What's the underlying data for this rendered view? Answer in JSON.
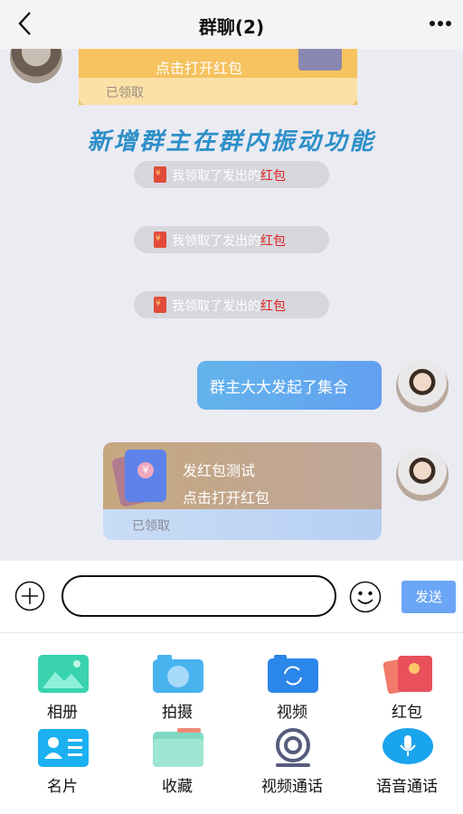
{
  "header": {
    "title": "群聊(2)"
  },
  "chat": {
    "top_packet": {
      "open_text": "点击打开红包",
      "status": "已领取"
    },
    "banner": "新增群主在群内振动功能",
    "notices": [
      {
        "prefix": "我领取了发出的",
        "highlight": "红包"
      },
      {
        "prefix": "我领取了发出的",
        "highlight": "红包"
      },
      {
        "prefix": "我领取了发出的",
        "highlight": "红包"
      }
    ],
    "message": "群主大大发起了集合",
    "packet": {
      "title": "发红包测试",
      "open_text": "点击打开红包",
      "status": "已领取"
    }
  },
  "input": {
    "placeholder": "",
    "send_label": "发送"
  },
  "panel": {
    "items": [
      {
        "label": "相册",
        "icon": "album-icon"
      },
      {
        "label": "拍摄",
        "icon": "camera-icon"
      },
      {
        "label": "视频",
        "icon": "video-icon"
      },
      {
        "label": "红包",
        "icon": "red-packet-icon"
      },
      {
        "label": "名片",
        "icon": "card-icon"
      },
      {
        "label": "收藏",
        "icon": "folder-icon"
      },
      {
        "label": "视频通话",
        "icon": "video-call-icon"
      },
      {
        "label": "语音通话",
        "icon": "voice-call-icon"
      }
    ]
  },
  "colors": {
    "accent": "#6aa6f5",
    "bubble": "#64b4ec",
    "highlight": "#e02020",
    "chat_bg": "#ebebf2"
  }
}
